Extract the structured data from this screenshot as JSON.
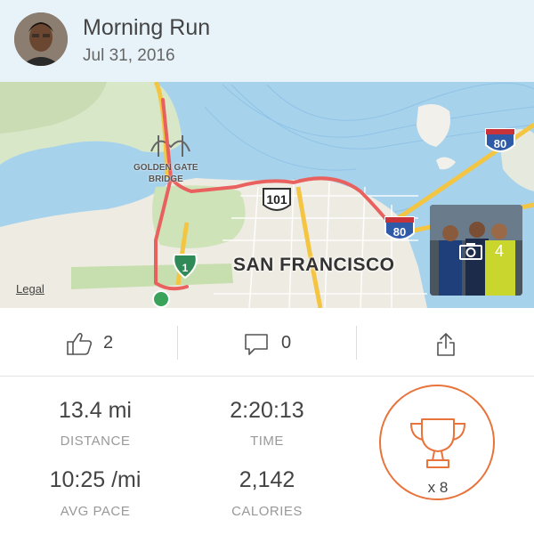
{
  "activity": {
    "title": "Morning Run",
    "date": "Jul 31, 2016"
  },
  "map": {
    "legal_label": "Legal",
    "city_label": "SAN FRANCISCO",
    "landmark_label_line1": "GOLDEN GATE",
    "landmark_label_line2": "BRIDGE",
    "route_color": "#e8615f",
    "highway_shields": [
      "101",
      "80",
      "80",
      "1"
    ]
  },
  "photos": {
    "count": "4",
    "icon": "camera-icon"
  },
  "social": {
    "kudos_count": "2",
    "comment_count": "0",
    "kudos_icon": "thumbs-up-icon",
    "comment_icon": "comment-icon",
    "share_icon": "share-icon"
  },
  "stats": {
    "distance_value": "13.4 mi",
    "distance_label": "DISTANCE",
    "time_value": "2:20:13",
    "time_label": "TIME",
    "pace_value": "10:25 /mi",
    "pace_label": "AVG PACE",
    "calories_value": "2,142",
    "calories_label": "CALORIES"
  },
  "achievements": {
    "icon": "trophy-icon",
    "count": "x 8",
    "accent_color": "#e8733b"
  }
}
